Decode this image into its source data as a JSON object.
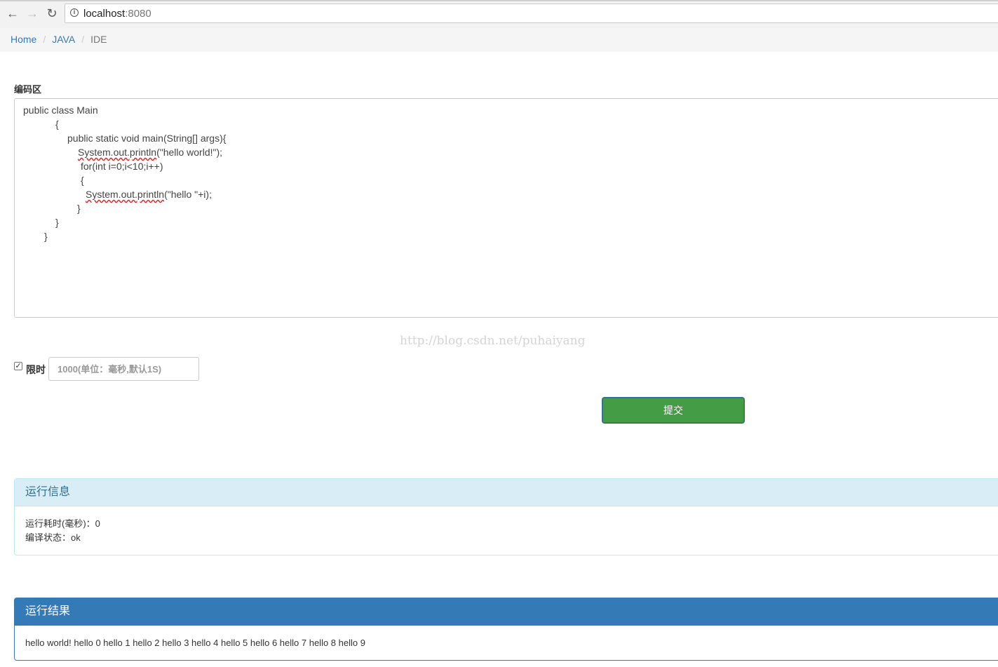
{
  "browser": {
    "url_host": "localhost",
    "url_port": ":8080"
  },
  "breadcrumb": {
    "items": [
      "Home",
      "JAVA"
    ],
    "active": "IDE",
    "separator": "/"
  },
  "editor": {
    "label": "编码区",
    "lines": [
      "public class Main",
      "{",
      "public static void main(String[] args){",
      "(\"hello world!\");",
      "for(int i=0;i<10;i++)",
      "{",
      "(\"hello \"+i);",
      "}",
      "}",
      "}"
    ],
    "flagged_token": "System.out.println"
  },
  "watermark": "http://blog.csdn.net/puhaiyang",
  "limit": {
    "checked": true,
    "label": "限时",
    "placeholder": "1000(单位：毫秒,默认1S)"
  },
  "submit_label": "提交",
  "run_info": {
    "title": "运行信息",
    "time_line": "运行耗时(毫秒)：0",
    "status_line": "编译状态：ok"
  },
  "run_result": {
    "title": "运行结果",
    "output": "hello world! hello 0 hello 1 hello 2 hello 3 hello 4 hello 5 hello 6 hello 7 hello 8 hello 9"
  },
  "colors": {
    "link": "#337ab7",
    "success": "#449d44",
    "info_bg": "#d9edf7",
    "primary": "#337ab7"
  }
}
